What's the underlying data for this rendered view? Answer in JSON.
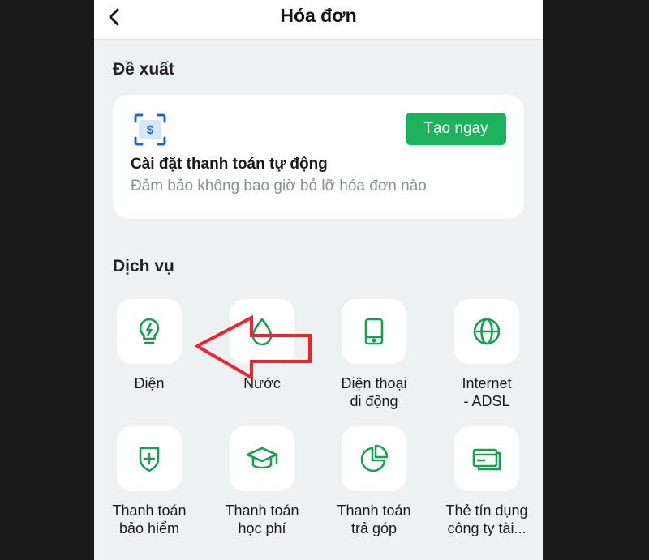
{
  "header": {
    "title": "Hóa đơn"
  },
  "suggestions": {
    "section_title": "Đề xuất",
    "card": {
      "title": "Cài đặt thanh toán tự động",
      "subtitle": "Đảm bảo không bao giờ bỏ lỡ hóa đơn nào",
      "button_label": "Tạo ngay",
      "icon": "autopay-scan-dollar-icon"
    }
  },
  "services": {
    "section_title": "Dịch vụ",
    "items": [
      {
        "label": "Điện",
        "icon": "lightbulb-icon"
      },
      {
        "label": "Nước",
        "icon": "water-drop-icon"
      },
      {
        "label": "Điện thoại\ndi động",
        "icon": "mobile-phone-icon"
      },
      {
        "label": "Internet\n- ADSL",
        "icon": "globe-icon"
      },
      {
        "label": "Thanh toán\nbảo hiểm",
        "icon": "shield-plus-icon"
      },
      {
        "label": "Thanh toán\nhọc phí",
        "icon": "graduation-cap-icon"
      },
      {
        "label": "Thanh toán\ntrả góp",
        "icon": "pie-chart-icon"
      },
      {
        "label": "Thẻ tín dụng\ncông ty tài...",
        "icon": "credit-card-icon"
      }
    ]
  },
  "colors": {
    "accent": "#1fb25c",
    "icon_green": "#1a9e50",
    "annotation_red": "#e8262b",
    "background": "#eef1f2"
  }
}
